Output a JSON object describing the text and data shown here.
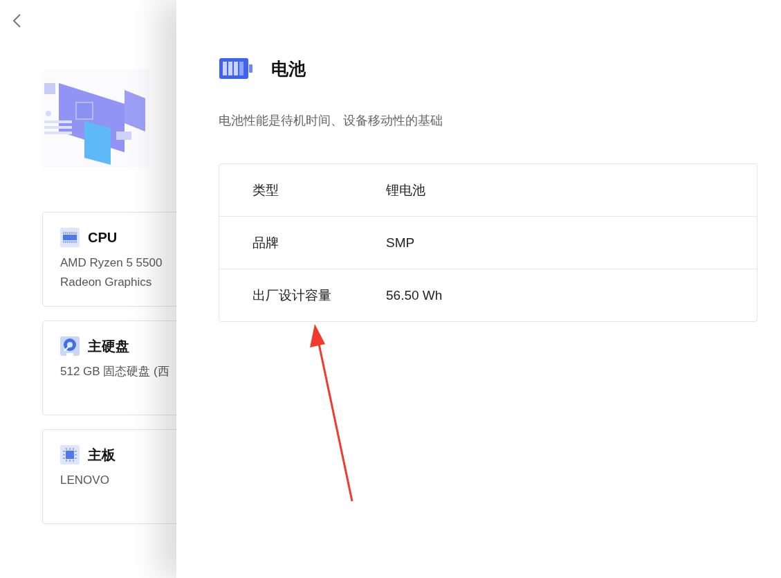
{
  "components": [
    {
      "kind": "cpu",
      "title": "CPU",
      "lines": [
        "AMD Ryzen 5 5500",
        "Radeon Graphics"
      ]
    },
    {
      "kind": "disk",
      "title": "主硬盘",
      "lines": [
        "512 GB 固态硬盘 (西"
      ]
    },
    {
      "kind": "board",
      "title": "主板",
      "lines": [
        "LENOVO"
      ]
    }
  ],
  "detail": {
    "title": "电池",
    "description": "电池性能是待机时间、设备移动性的基础",
    "specs": [
      {
        "label": "类型",
        "value": "锂电池"
      },
      {
        "label": "品牌",
        "value": "SMP"
      },
      {
        "label": "出厂设计容量",
        "value": "56.50 Wh"
      }
    ]
  }
}
